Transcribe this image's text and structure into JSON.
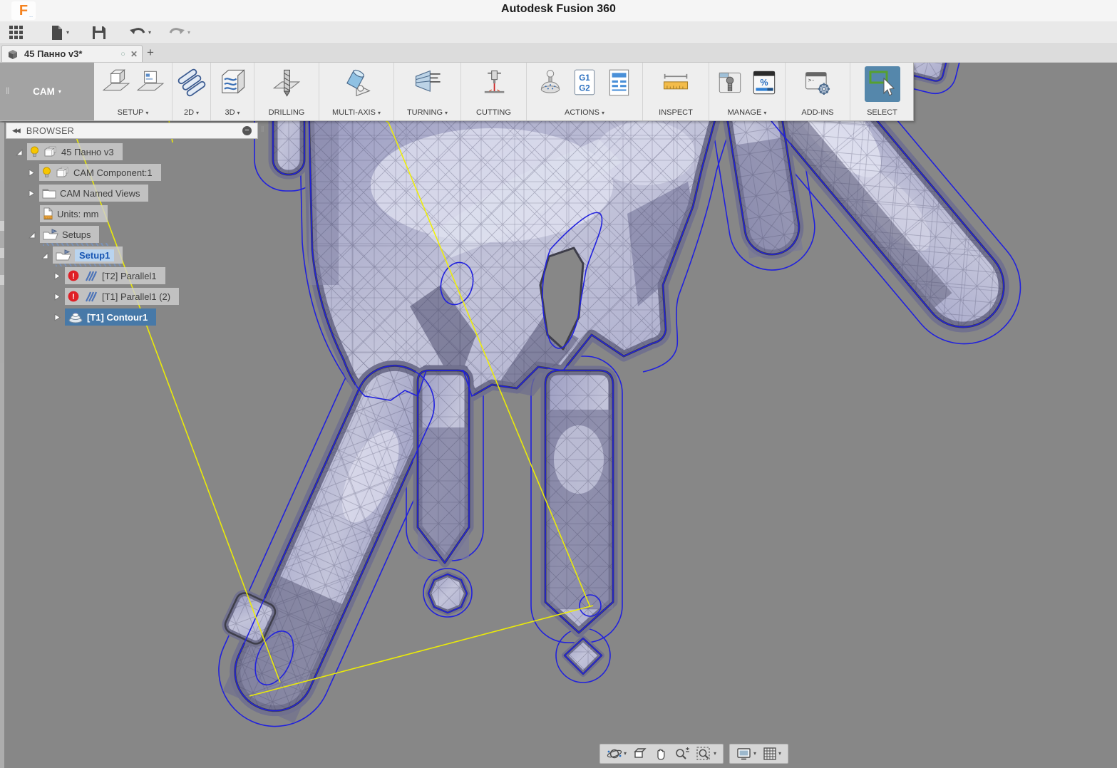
{
  "window": {
    "title": "Autodesk Fusion 360"
  },
  "icons": {
    "caret": "▾",
    "collapse": "◀◀",
    "minus": "−",
    "grip": "‖",
    "handle": "‖",
    "tab_circle": "○",
    "tab_close": "✕",
    "new_tab": "+",
    "error": "!",
    "g1": "G1",
    "g2": "G2",
    "percent": "%",
    "prompt": ">-",
    "qat_icons": [
      "app-grid",
      "file-new",
      "save",
      "undo",
      "redo"
    ],
    "navbar_icons": [
      "orbit",
      "look-at",
      "pan",
      "zoom",
      "fit",
      "display-settings",
      "grid-settings"
    ]
  },
  "tab": {
    "label": "45 Панно v3*"
  },
  "ribbon": {
    "workspace": "CAM",
    "panels": [
      {
        "label": "SETUP",
        "dropdown": true
      },
      {
        "label": "2D",
        "dropdown": true
      },
      {
        "label": "3D",
        "dropdown": true
      },
      {
        "label": "DRILLING",
        "dropdown": false
      },
      {
        "label": "MULTI-AXIS",
        "dropdown": true
      },
      {
        "label": "TURNING",
        "dropdown": true
      },
      {
        "label": "CUTTING",
        "dropdown": false
      },
      {
        "label": "ACTIONS",
        "dropdown": true
      },
      {
        "label": "INSPECT",
        "dropdown": false
      },
      {
        "label": "MANAGE",
        "dropdown": true
      },
      {
        "label": "ADD-INS",
        "dropdown": false
      },
      {
        "label": "SELECT",
        "dropdown": false
      }
    ]
  },
  "browser": {
    "header": "BROWSER",
    "rows": [
      {
        "label": "45 Панно v3"
      },
      {
        "label": "CAM Component:1"
      },
      {
        "label": "CAM Named Views"
      },
      {
        "label": "Units: mm"
      },
      {
        "label": "Setups"
      },
      {
        "label": "Setup1"
      },
      {
        "label": "[T2] Parallel1"
      },
      {
        "label": "[T1] Parallel1 (2)"
      },
      {
        "label": "[T1] Contour1"
      }
    ]
  },
  "viewport": {
    "background": "#878787",
    "mesh_color": "#b9badb",
    "mesh_dark_band": "#7d80a2",
    "toolpath_contour_color": "#2121dd",
    "rapid_move_color": "#f0f000",
    "selection_color": "#4779a8",
    "select_tool_color": "#5587ab"
  }
}
